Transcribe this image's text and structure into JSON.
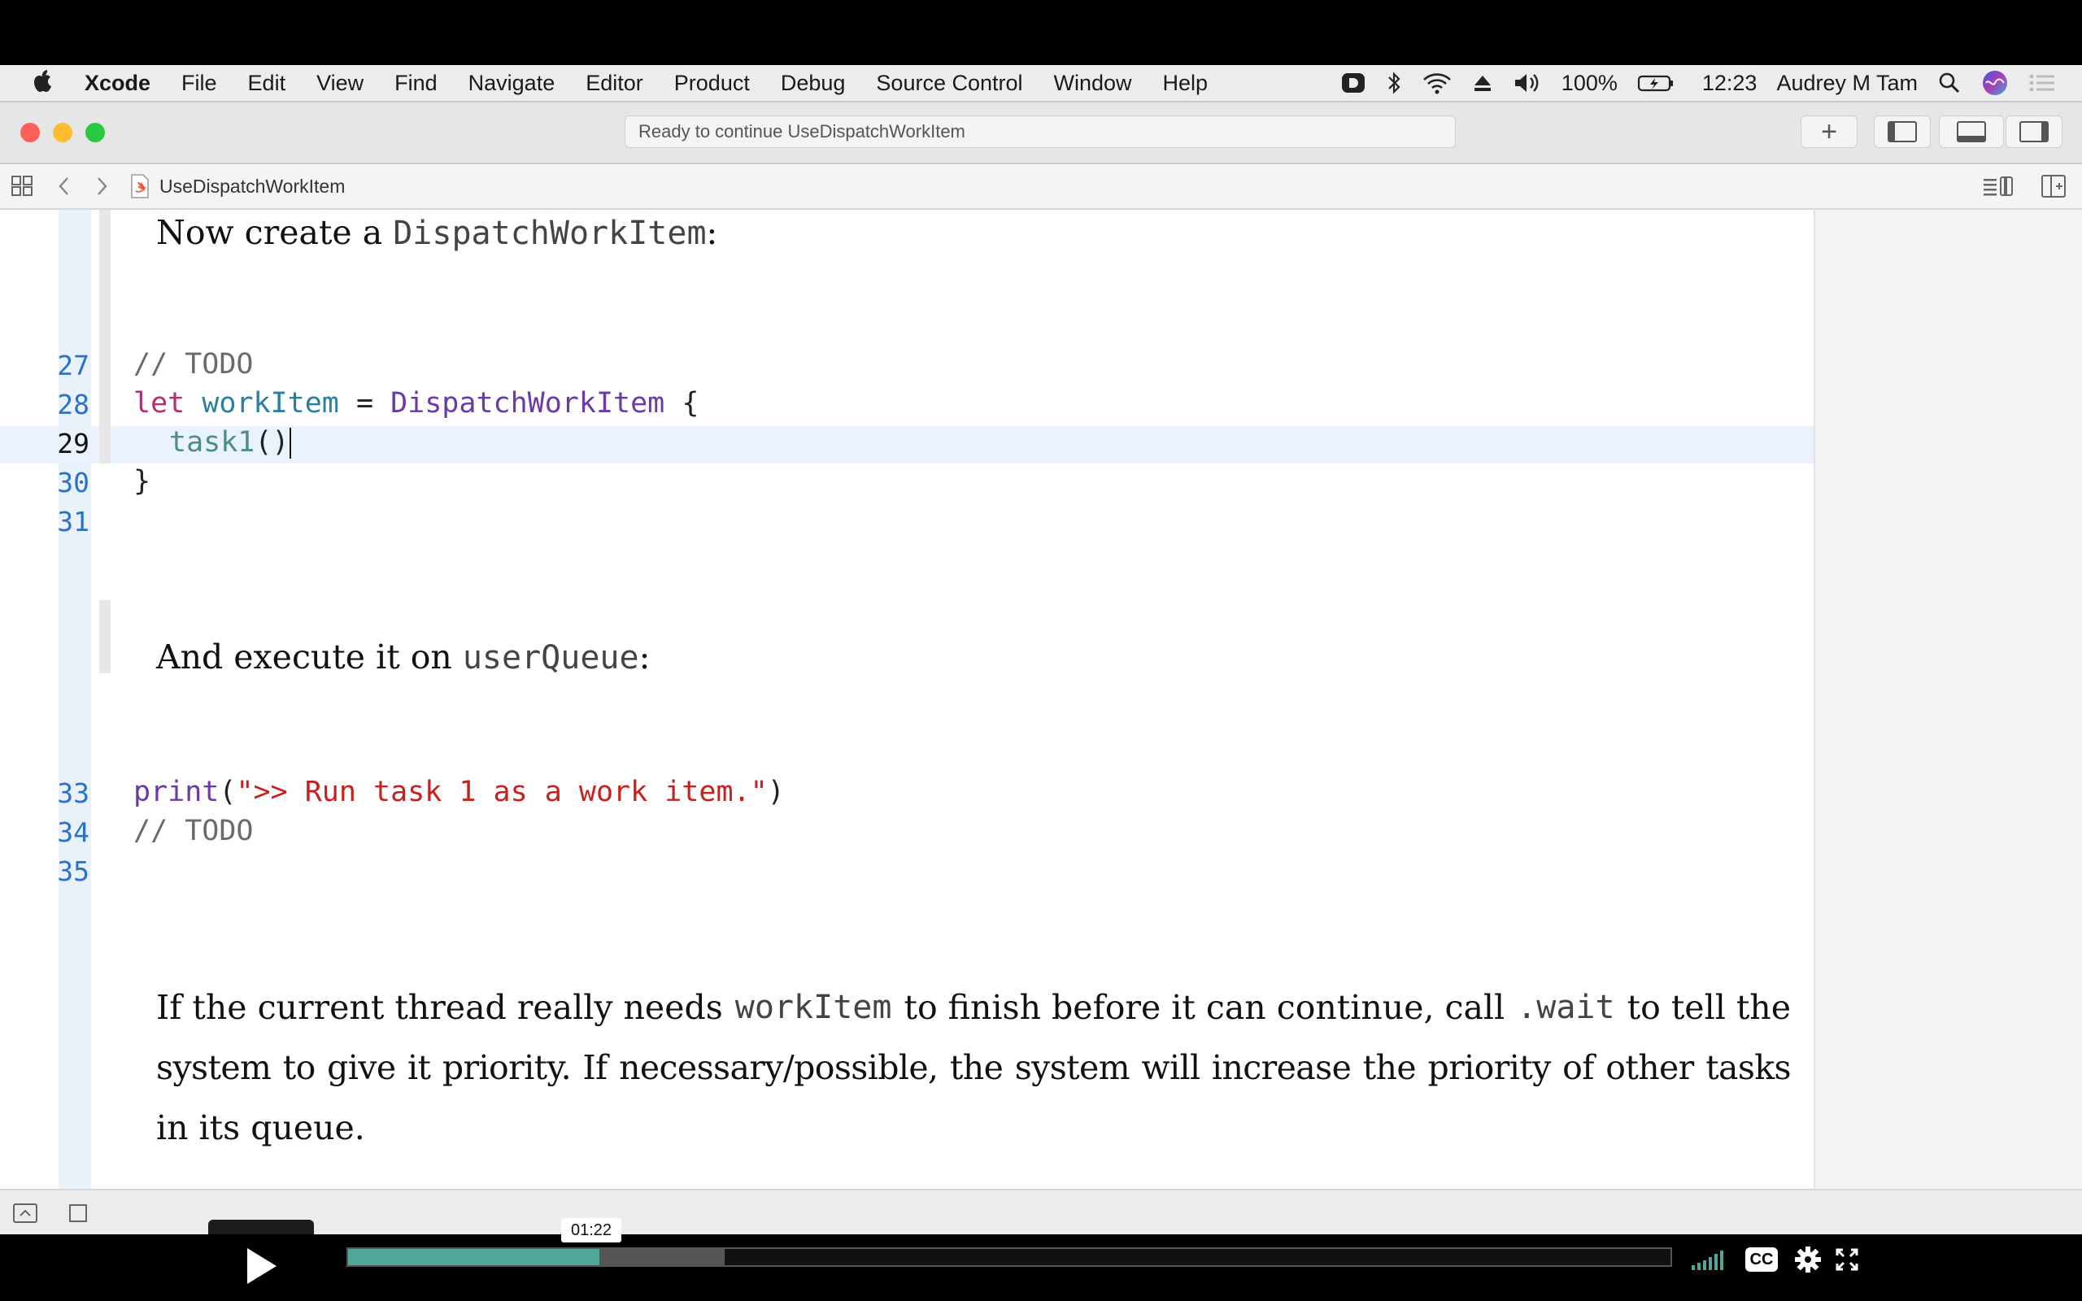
{
  "menubar": {
    "app": "Xcode",
    "items": [
      "File",
      "Edit",
      "View",
      "Find",
      "Navigate",
      "Editor",
      "Product",
      "Debug",
      "Source Control",
      "Window",
      "Help"
    ],
    "battery": "100%",
    "time": "12:23",
    "user": "Audrey M Tam"
  },
  "toolbar": {
    "activity_text": "Ready to continue UseDispatchWorkItem",
    "add_label": "+"
  },
  "jumpbar": {
    "file": "UseDispatchWorkItem"
  },
  "prose": {
    "p1_a": "Now create a ",
    "p1_code": "DispatchWorkItem",
    "p1_b": ":",
    "p2_a": "And execute it on ",
    "p2_code": "userQueue",
    "p2_b": ":",
    "p3_l1_a": "If the current thread really needs ",
    "p3_l1_code1": "workItem",
    "p3_l1_b": " to finish before it can continue, call ",
    "p3_l1_code2": ".wait",
    "p3_l1_c": " to tell the",
    "p3_l2": "system to give it priority. If necessary/possible, the system will increase the priority of other tasks",
    "p3_l3": "in its queue."
  },
  "code": {
    "line_numbers": [
      "27",
      "28",
      "29",
      "30",
      "31",
      "33",
      "34",
      "35"
    ],
    "l27": "// TODO",
    "l28_kw": "let",
    "l28_var": "workItem",
    "l28_eq": " = ",
    "l28_type": "DispatchWorkItem",
    "l28_brace": " {",
    "l29_fn": "task1",
    "l29_paren": "()",
    "l30": "}",
    "l33_fn": "print",
    "l33_open": "(",
    "l33_str": "\">> Run task 1 as a work item.\"",
    "l33_close": ")",
    "l34": "// TODO"
  },
  "player": {
    "current_time": "01:22",
    "played_fraction": 0.19,
    "buffered_fraction": 0.285,
    "cc_label": "CC"
  },
  "colors": {
    "accent_progress": "#4fa897",
    "line_number": "#2a72c7",
    "keyword": "#b2306e",
    "string": "#c5221f"
  }
}
